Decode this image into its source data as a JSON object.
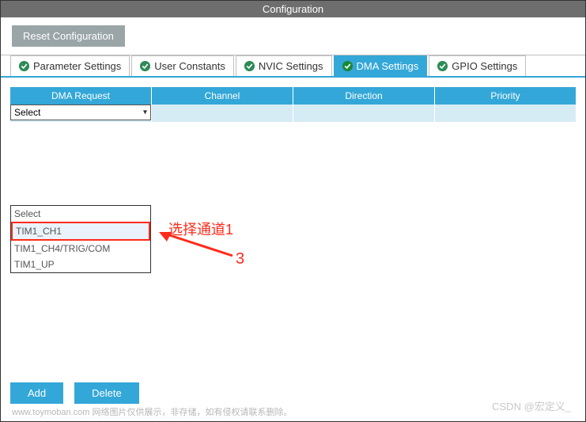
{
  "header": {
    "title": "Configuration"
  },
  "reset": {
    "label": "Reset Configuration"
  },
  "tabs": [
    {
      "label": "Parameter Settings"
    },
    {
      "label": "User Constants"
    },
    {
      "label": "NVIC Settings"
    },
    {
      "label": "DMA Settings"
    },
    {
      "label": "GPIO Settings"
    }
  ],
  "table": {
    "headers": [
      "DMA Request",
      "Channel",
      "Direction",
      "Priority"
    ]
  },
  "select": {
    "value": "Select"
  },
  "dropdown": {
    "items": [
      "Select",
      "TIM1_CH1",
      "TIM1_CH4/TRIG/COM",
      "TIM1_UP"
    ]
  },
  "annotations": {
    "text": "选择通道1",
    "number": "3"
  },
  "buttons": {
    "add": "Add",
    "delete": "Delete"
  },
  "watermark": {
    "left": "www.toymoban.com 网络图片仅供展示，非存储，如有侵权请联系删除。",
    "right": "CSDN @宏定义_"
  }
}
